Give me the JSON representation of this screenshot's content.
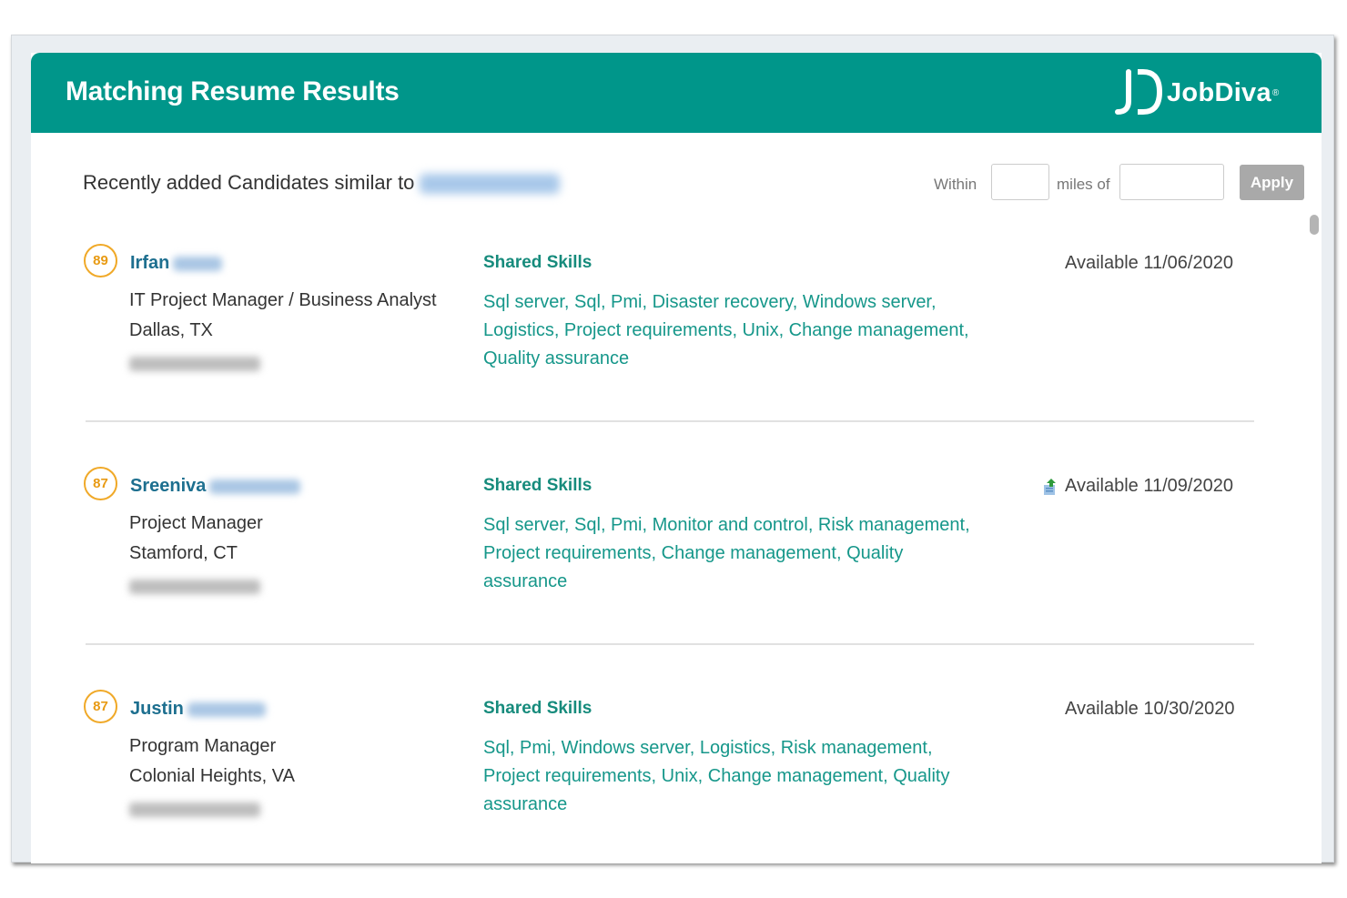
{
  "header": {
    "title": "Matching Resume Results",
    "logo_text": "JobDiva",
    "logo_mark": "®"
  },
  "toolbar": {
    "similar_label": "Recently added Candidates similar to",
    "within_label": "Within",
    "within_value": "",
    "miles_label": "miles of",
    "miles_value": "",
    "apply_label": "Apply"
  },
  "results": [
    {
      "score": "89",
      "first_name": "Irfan",
      "title": "IT Project Manager / Business Analyst",
      "location": "Dallas, TX",
      "skills_heading": "Shared Skills",
      "skills": "Sql server, Sql, Pmi, Disaster recovery, Windows server, Logistics, Project requirements, Unix, Change management, Quality assurance",
      "availability": "Available 11/06/2020",
      "has_upload_icon": false
    },
    {
      "score": "87",
      "first_name": "Sreeniva",
      "title": "Project Manager",
      "location": "Stamford, CT",
      "skills_heading": "Shared Skills",
      "skills": "Sql server, Sql, Pmi, Monitor and control, Risk management, Project requirements, Change management, Quality assurance",
      "availability": "Available 11/09/2020",
      "has_upload_icon": true
    },
    {
      "score": "87",
      "first_name": "Justin",
      "title": "Program Manager",
      "location": "Colonial Heights, VA",
      "skills_heading": "Shared Skills",
      "skills": "Sql, Pmi, Windows server, Logistics, Risk management, Project requirements, Unix, Change management, Quality assurance",
      "availability": "Available 10/30/2020",
      "has_upload_icon": false
    }
  ],
  "colors": {
    "header_bg": "#00968a",
    "skill_text": "#16978a",
    "name_text": "#1d6f8f",
    "score_ring": "#f0a928",
    "apply_bg": "#a9a9a9"
  },
  "icons": {
    "logo": "jobdiva-jd-logo-icon",
    "upload": "upload-arrow-icon"
  }
}
